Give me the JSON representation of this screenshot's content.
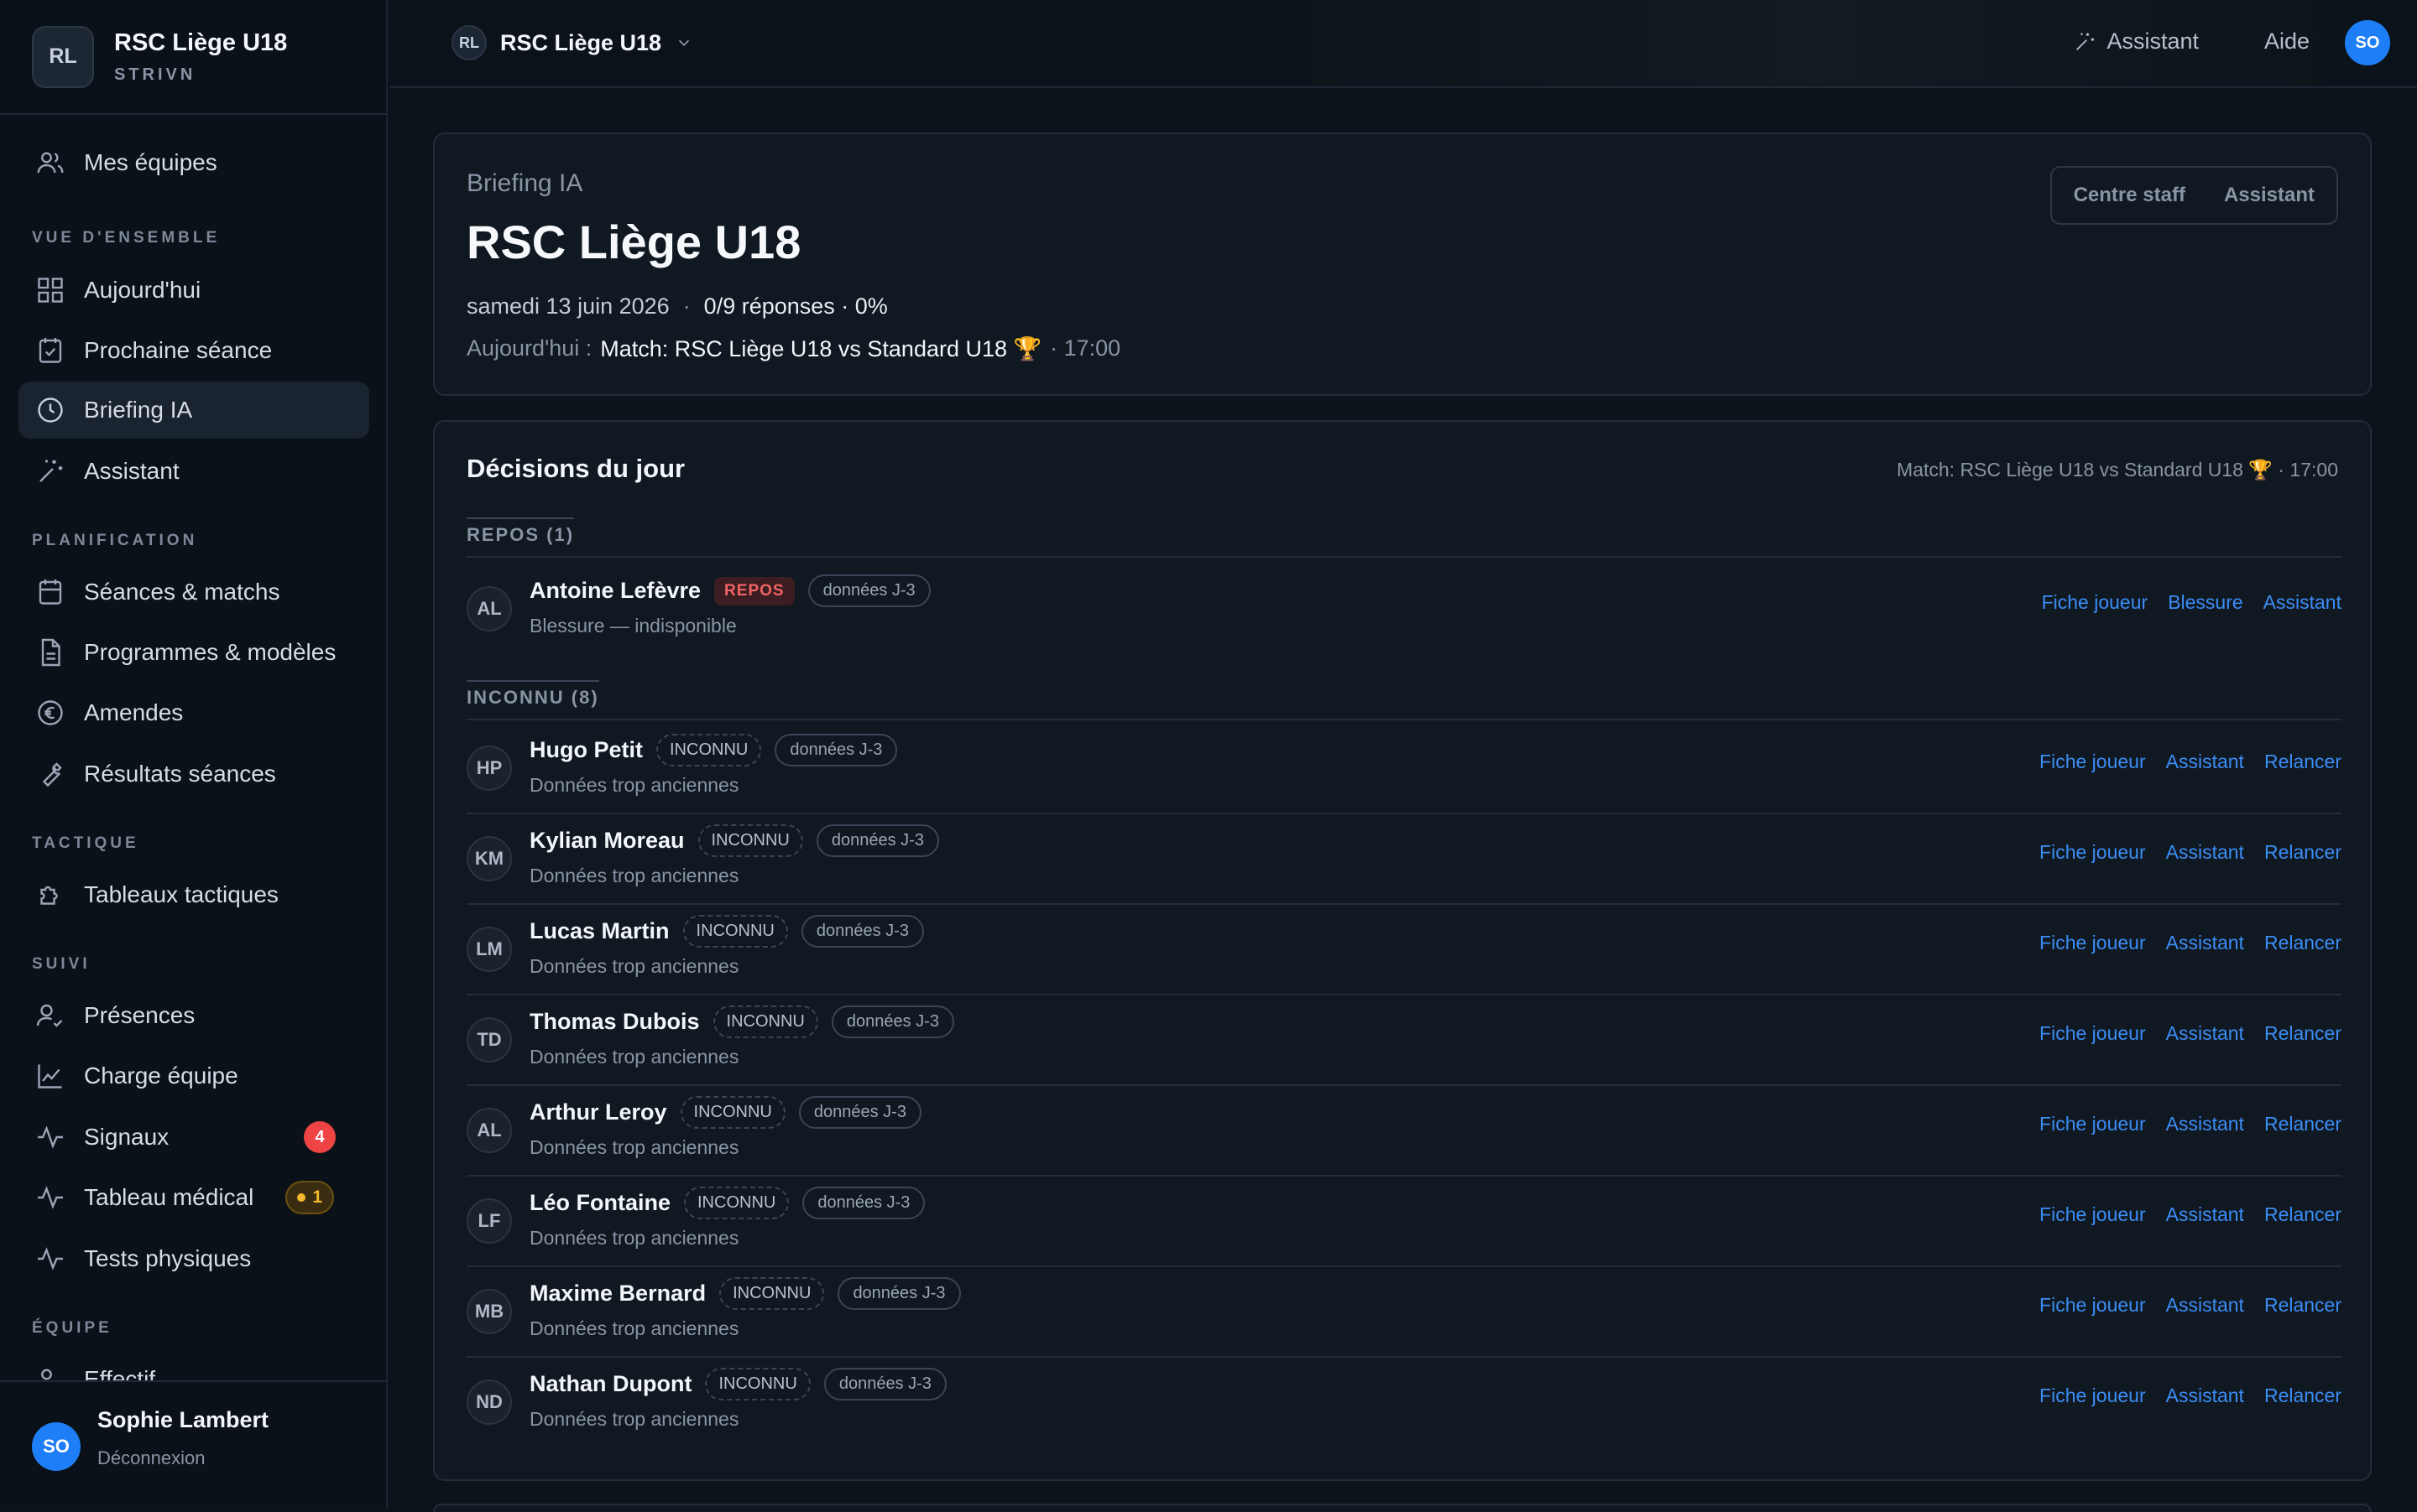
{
  "sidebar": {
    "logo": "RL",
    "club": "RSC Liège U18",
    "brand": "STRIVN",
    "teams": "Mes équipes",
    "sections": {
      "overview": "VUE D'ENSEMBLE",
      "planning": "PLANIFICATION",
      "tactics": "TACTIQUE",
      "tracking": "SUIVI",
      "team": "ÉQUIPE"
    },
    "items": {
      "today": "Aujourd'hui",
      "next": "Prochaine séance",
      "briefing": "Briefing IA",
      "assistant": "Assistant",
      "sessions": "Séances & matchs",
      "programs": "Programmes & modèles",
      "fines": "Amendes",
      "results": "Résultats séances",
      "boards": "Tableaux tactiques",
      "presence": "Présences",
      "load": "Charge équipe",
      "signals": "Signaux",
      "medical": "Tableau médical",
      "tests": "Tests physiques",
      "roster": "Effectif"
    },
    "signals_badge": "4",
    "medical_badge": "1",
    "user": {
      "initials": "SO",
      "name": "Sophie Lambert",
      "logout": "Déconnexion"
    }
  },
  "topbar": {
    "team_initials": "RL",
    "team_name": "RSC Liège U18",
    "assistant": "Assistant",
    "help": "Aide",
    "user_initials": "SO"
  },
  "briefing": {
    "label": "Briefing IA",
    "title": "RSC Liège U18",
    "date": "samedi 13 juin 2026",
    "dot": "·",
    "responses": "0/9 réponses · 0%",
    "today_label": "Aujourd'hui :",
    "today_event": "Match: RSC Liège U18 vs Standard U18 🏆",
    "today_time": "· 17:00",
    "btn_staff": "Centre staff",
    "btn_assistant": "Assistant"
  },
  "decisions": {
    "title": "Décisions du jour",
    "match": "Match: RSC Liège U18 vs Standard U18 🏆 · 17:00",
    "rest_header": "REPOS (1)",
    "unknown_header": "INCONNU (8)",
    "rest_player": {
      "initials": "AL",
      "name": "Antoine Lefèvre",
      "status": "REPOS",
      "data": "données J-3",
      "note": "Blessure — indisponible",
      "a1": "Fiche joueur",
      "a2": "Blessure",
      "a3": "Assistant"
    },
    "unknown_players": [
      {
        "initials": "HP",
        "name": "Hugo Petit",
        "status": "INCONNU",
        "data": "données J-3",
        "note": "Données trop anciennes",
        "a1": "Fiche joueur",
        "a2": "Assistant",
        "a3": "Relancer"
      },
      {
        "initials": "KM",
        "name": "Kylian Moreau",
        "status": "INCONNU",
        "data": "données J-3",
        "note": "Données trop anciennes",
        "a1": "Fiche joueur",
        "a2": "Assistant",
        "a3": "Relancer"
      },
      {
        "initials": "LM",
        "name": "Lucas Martin",
        "status": "INCONNU",
        "data": "données J-3",
        "note": "Données trop anciennes",
        "a1": "Fiche joueur",
        "a2": "Assistant",
        "a3": "Relancer"
      },
      {
        "initials": "TD",
        "name": "Thomas Dubois",
        "status": "INCONNU",
        "data": "données J-3",
        "note": "Données trop anciennes",
        "a1": "Fiche joueur",
        "a2": "Assistant",
        "a3": "Relancer"
      },
      {
        "initials": "AL",
        "name": "Arthur Leroy",
        "status": "INCONNU",
        "data": "données J-3",
        "note": "Données trop anciennes",
        "a1": "Fiche joueur",
        "a2": "Assistant",
        "a3": "Relancer"
      },
      {
        "initials": "LF",
        "name": "Léo Fontaine",
        "status": "INCONNU",
        "data": "données J-3",
        "note": "Données trop anciennes",
        "a1": "Fiche joueur",
        "a2": "Assistant",
        "a3": "Relancer"
      },
      {
        "initials": "MB",
        "name": "Maxime Bernard",
        "status": "INCONNU",
        "data": "données J-3",
        "note": "Données trop anciennes",
        "a1": "Fiche joueur",
        "a2": "Assistant",
        "a3": "Relancer"
      },
      {
        "initials": "ND",
        "name": "Nathan Dupont",
        "status": "INCONNU",
        "data": "données J-3",
        "note": "Données trop anciennes",
        "a1": "Fiche joueur",
        "a2": "Assistant",
        "a3": "Relancer"
      }
    ]
  }
}
